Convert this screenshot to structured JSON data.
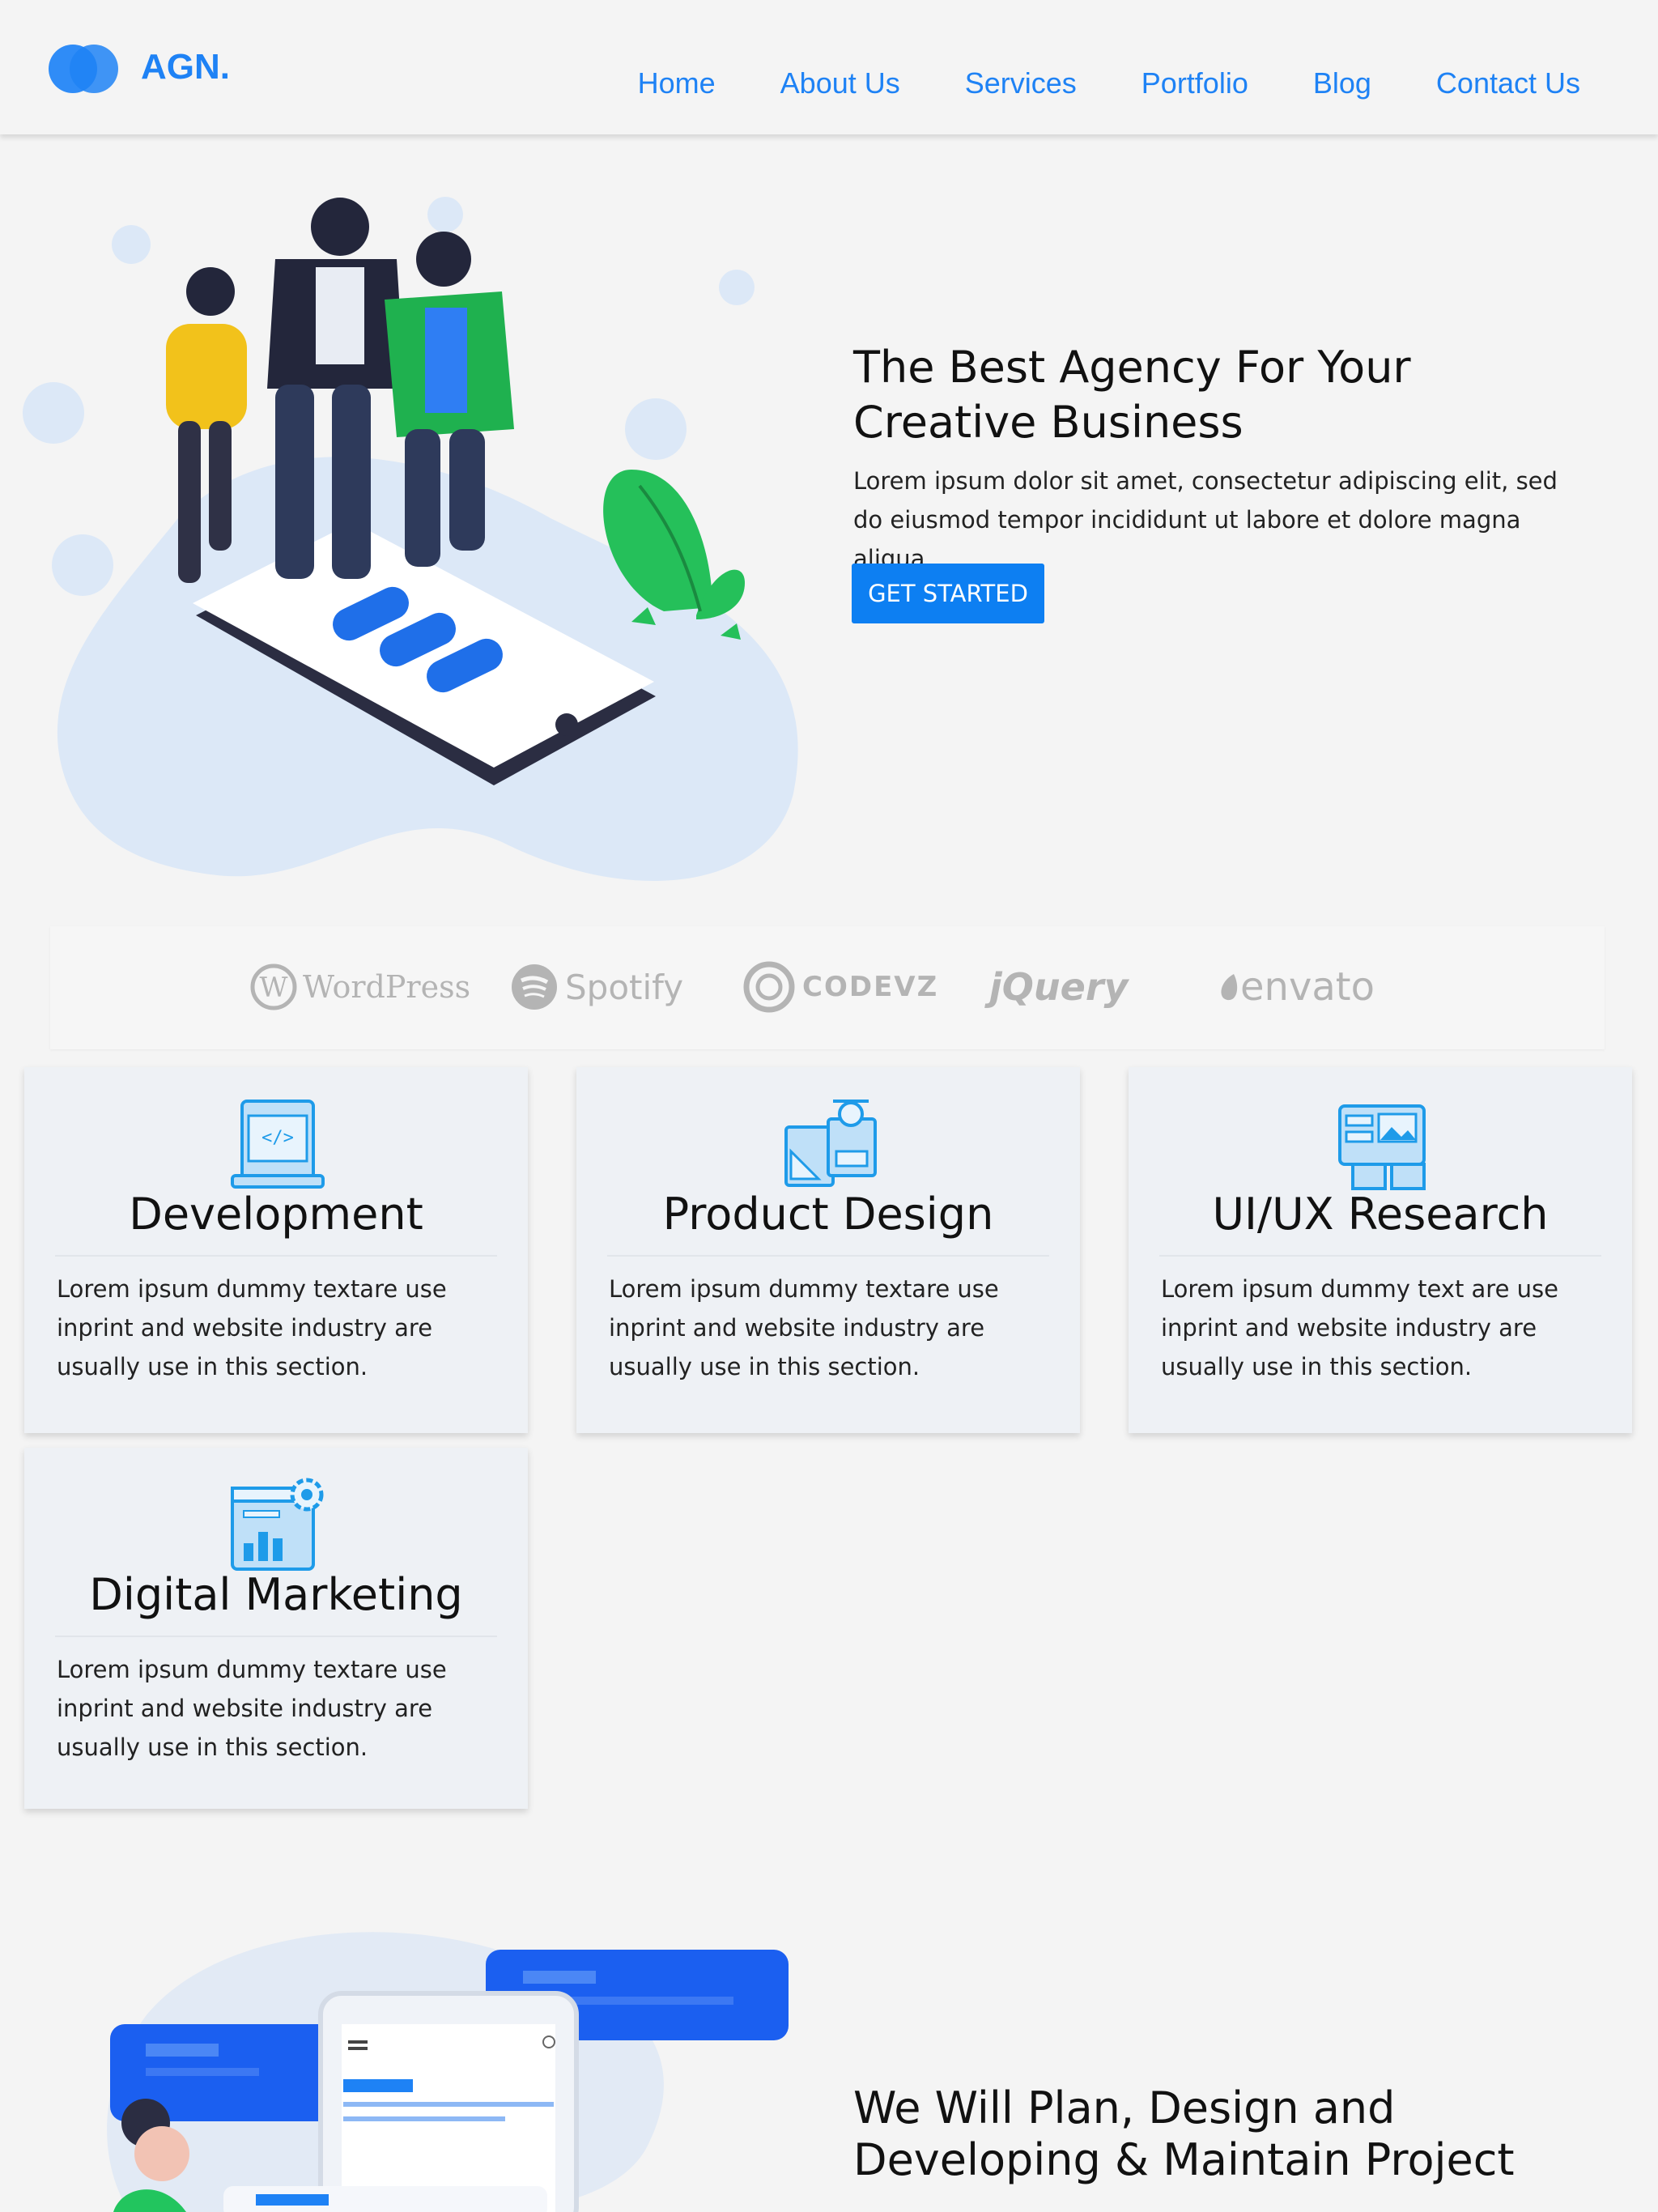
{
  "header": {
    "logo_text": "AGN.",
    "nav": [
      "Home",
      "About Us",
      "Services",
      "Portfolio",
      "Blog",
      "Contact Us"
    ]
  },
  "hero": {
    "title": "The Best Agency For Your Creative Business",
    "text": "Lorem ipsum dolor sit amet, consectetur adipiscing elit, sed do eiusmod tempor incididunt ut labore et dolore magna aliqua.",
    "button": "GET STARTED"
  },
  "brands": [
    "WordPress",
    "Spotify",
    "CODEVZ",
    "jQuery",
    "envato"
  ],
  "services": [
    {
      "title": "Development",
      "text": "Lorem ipsum dummy textare use inprint and website industry are usually use in this section.",
      "icon": "code-window-icon"
    },
    {
      "title": "Product Design",
      "text": "Lorem ipsum dummy textare use inprint and website industry are usually use in this section.",
      "icon": "design-tools-icon"
    },
    {
      "title": "UI/UX Research",
      "text": "Lorem ipsum dummy text are use inprint and website industry are usually use in this section.",
      "icon": "layout-research-icon"
    },
    {
      "title": "Digital Marketing",
      "text": "Lorem ipsum dummy textare use inprint and website industry are usually use in this section.",
      "icon": "analytics-gear-icon"
    }
  ],
  "plan": {
    "title": "We Will Plan, Design and Developing & Maintain Project"
  },
  "colors": {
    "accent": "#1e82f5",
    "button": "#0d7ff2",
    "background": "#f4f4f4",
    "card": "#eef1f5"
  }
}
